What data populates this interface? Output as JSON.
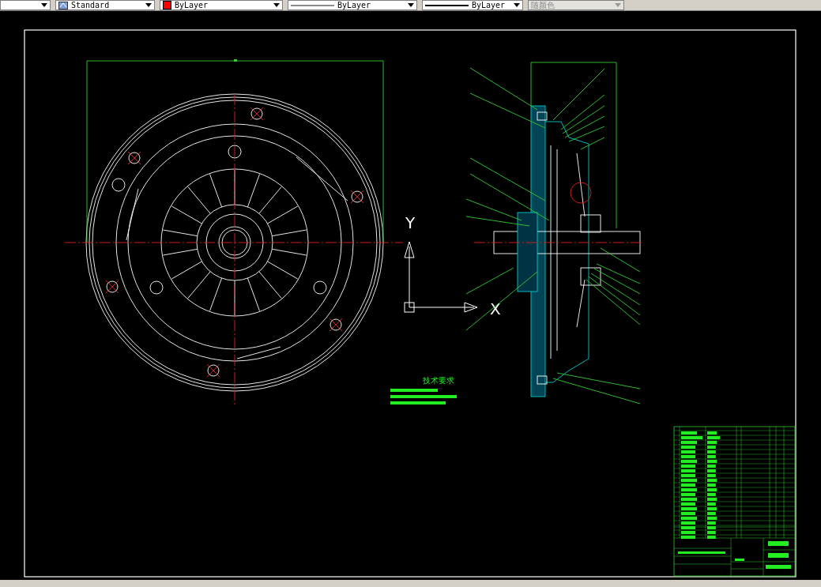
{
  "toolbar": {
    "dropdowns": [
      {
        "kind": "blank",
        "disabled": false
      },
      {
        "kind": "text-style",
        "label": "Standard",
        "disabled": false
      },
      {
        "kind": "color",
        "label": "ByLayer",
        "disabled": false
      },
      {
        "kind": "linetype",
        "label": "ByLayer",
        "disabled": false
      },
      {
        "kind": "lineweight",
        "label": "ByLayer",
        "disabled": false
      },
      {
        "kind": "plot-style",
        "label": "随颜色",
        "disabled": true
      }
    ]
  },
  "drawing": {
    "notes_title": "技术要求",
    "ucs": {
      "y_label": "Y",
      "x_label": "X"
    }
  }
}
